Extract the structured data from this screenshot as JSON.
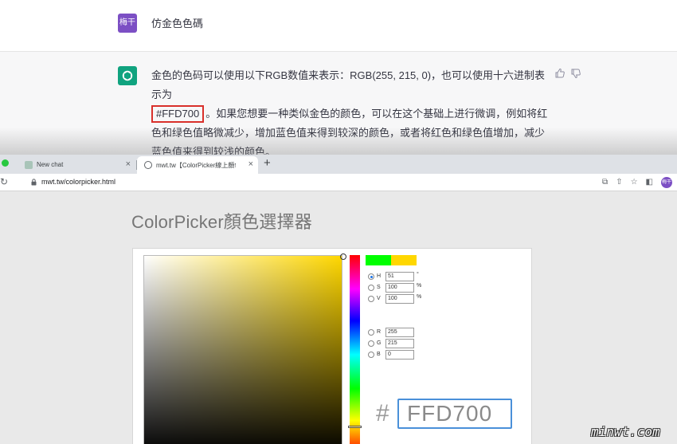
{
  "chat": {
    "user_avatar_text": "梅干",
    "user_message": "仿金色色碼",
    "ai_message_before": "金色的色码可以使用以下RGB数值来表示：RGB(255, 215, 0)，也可以使用十六进制表示为",
    "ai_hex": "#FFD700",
    "ai_message_after": "。如果您想要一种类似金色的颜色，可以在这个基础上进行微调，例如将红色和绿色值略微减少，增加蓝色值来得到较深的颜色，或者将红色和绿色值增加，减少蓝色值来得到较浅的颜色。"
  },
  "browser": {
    "tabs": [
      {
        "label": "New chat",
        "close": "×"
      },
      {
        "label": "mwt.tw【ColorPicker線上顏色選擇器】",
        "close": "×"
      }
    ],
    "new_tab": "+",
    "url": "mwt.tw/colorpicker.html",
    "profile_text": "梅干",
    "icons": [
      "translate-icon",
      "share-icon",
      "star-icon",
      "sidepanel-icon",
      "profile-avatar"
    ]
  },
  "colorpicker": {
    "title": "ColorPicker顏色選擇器",
    "hsv": [
      {
        "label": "H",
        "value": "51",
        "unit": "°",
        "selected": true
      },
      {
        "label": "S",
        "value": "100",
        "unit": "%",
        "selected": false
      },
      {
        "label": "V",
        "value": "100",
        "unit": "%",
        "selected": false
      }
    ],
    "rgb": [
      {
        "label": "R",
        "value": "255"
      },
      {
        "label": "G",
        "value": "215"
      },
      {
        "label": "B",
        "value": "0"
      }
    ],
    "hex_sign": "#",
    "hex_value": "FFD700",
    "swatch_new": "#00ff00",
    "swatch_old": "#ffd700"
  },
  "watermark": "minwt.com"
}
